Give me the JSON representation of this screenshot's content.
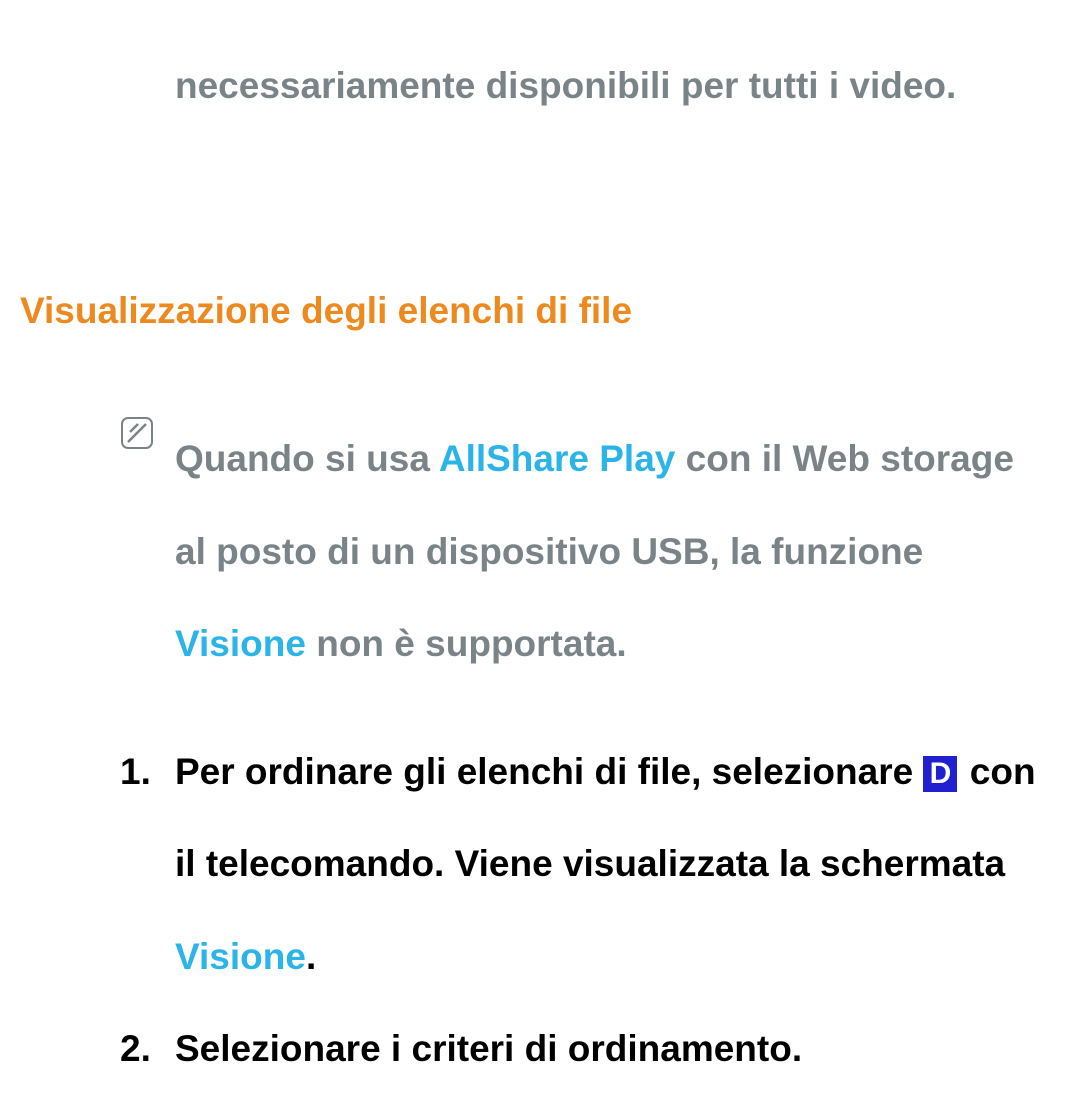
{
  "intro": {
    "text": "necessariamente disponibili per tutti i video."
  },
  "heading": "Visualizzazione degli elenchi di file",
  "note": {
    "part1": "Quando si usa ",
    "highlight1": "AllShare Play",
    "part2": " con il Web storage al posto di un dispositivo USB, la funzione ",
    "highlight2": "Visione",
    "part3": " non è supportata."
  },
  "list": {
    "item1": {
      "number": "1.",
      "part1": "Per ordinare gli elenchi di file, selezionare ",
      "button": "D",
      "part2": " con il telecomando. Viene visualizzata la schermata ",
      "highlight": "Visione",
      "part3": "."
    },
    "item2": {
      "number": "2.",
      "text": "Selezionare i criteri di ordinamento."
    }
  }
}
